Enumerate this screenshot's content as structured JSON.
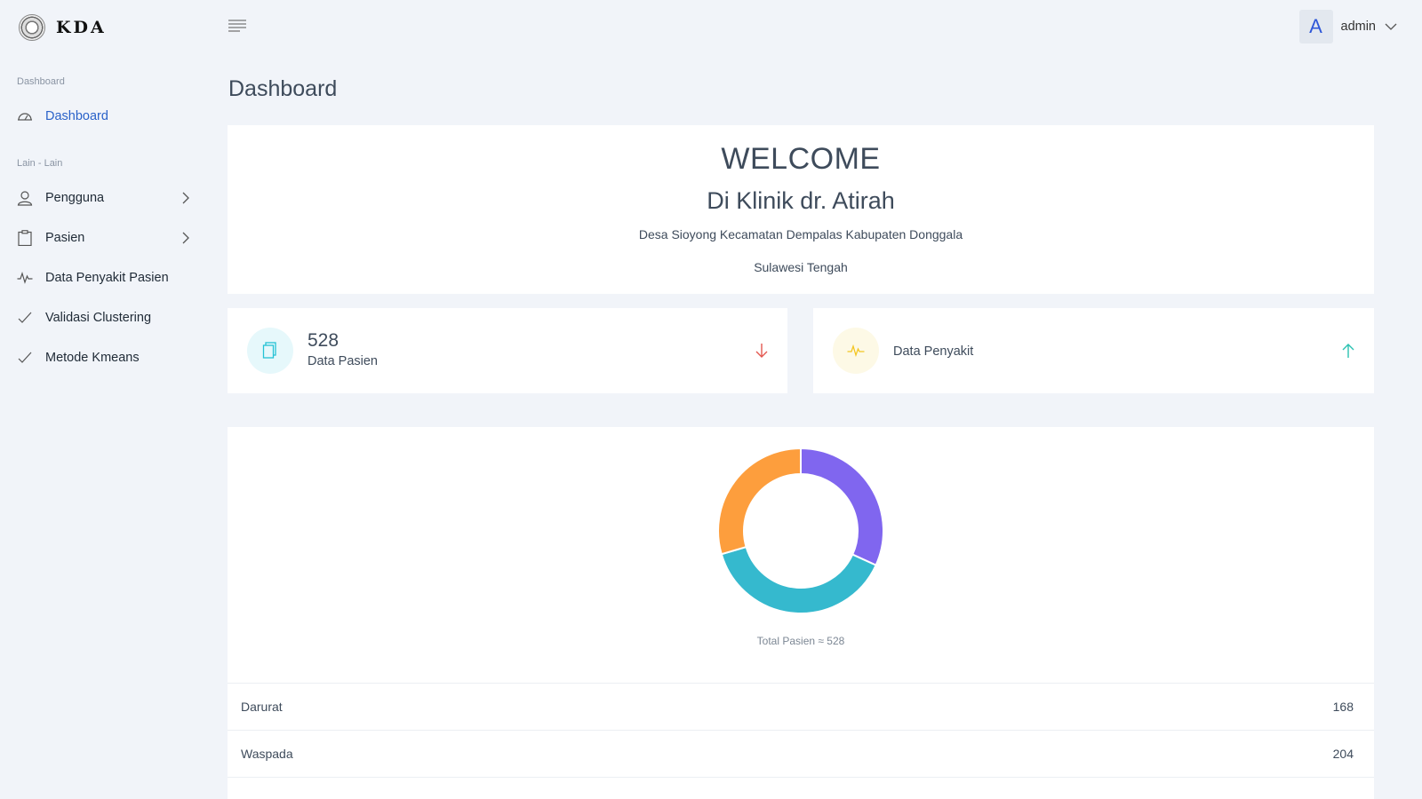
{
  "brand": {
    "name": "KDA"
  },
  "sidebar": {
    "sections": [
      {
        "label": "Dashboard"
      },
      {
        "label": "Lain - Lain"
      }
    ],
    "items": [
      {
        "label": "Dashboard",
        "icon": "gauge-icon"
      },
      {
        "label": "Pengguna",
        "icon": "user-icon"
      },
      {
        "label": "Pasien",
        "icon": "clipboard-icon"
      },
      {
        "label": "Data Penyakit Pasien",
        "icon": "pulse-icon"
      },
      {
        "label": "Validasi Clustering",
        "icon": "check-icon"
      },
      {
        "label": "Metode Kmeans",
        "icon": "check-icon"
      }
    ]
  },
  "header": {
    "avatar_letter": "A",
    "user_name": "admin"
  },
  "page": {
    "title": "Dashboard"
  },
  "welcome": {
    "title": "WELCOME",
    "subtitle": "Di Klinik dr. Atirah",
    "address_line1": "Desa Sioyong Kecamatan Dempalas Kabupaten Donggala",
    "address_line2": "Sulawesi Tengah"
  },
  "stats": [
    {
      "value": "528",
      "label": "Data Pasien",
      "icon": "document-icon",
      "arrow": "arrow-down-icon",
      "color": "#25c2d5"
    },
    {
      "value": "",
      "label": "Data Penyakit",
      "icon": "pulse-icon",
      "arrow": "arrow-up-icon",
      "color": "#f3c623"
    }
  ],
  "chart_data": {
    "type": "pie",
    "title": "",
    "categories": [
      "Darurat",
      "Waspada",
      ""
    ],
    "values": [
      168,
      204,
      156
    ],
    "colors": [
      "#8066ef",
      "#35b9ce",
      "#fd9e3d"
    ],
    "total_label": "Total Pasien ≈ 528"
  },
  "list": [
    {
      "label": "Darurat",
      "value": "168"
    },
    {
      "label": "Waspada",
      "value": "204"
    }
  ]
}
